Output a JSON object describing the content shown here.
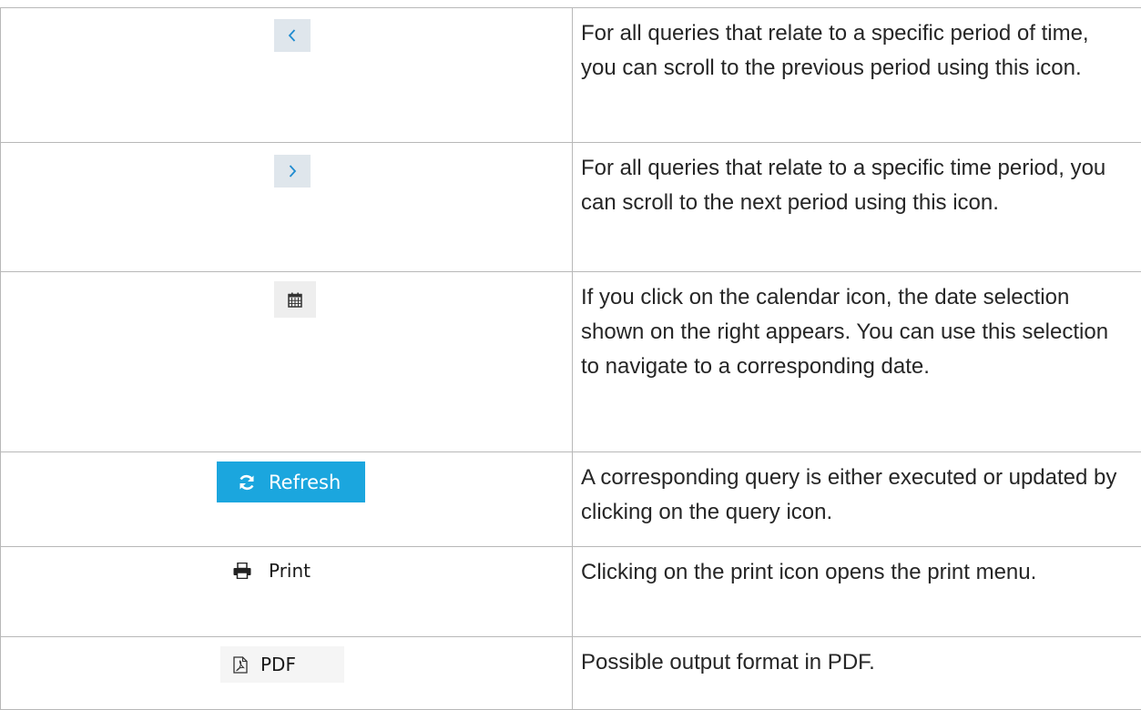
{
  "rows": [
    {
      "icon": "chevron-left-icon",
      "description": "For all queries that relate to a specific period of time, you can scroll to the previous period using this icon."
    },
    {
      "icon": "chevron-right-icon",
      "description": "For all queries that relate to a specific time period, you can scroll to the next period using this icon."
    },
    {
      "icon": "calendar-icon",
      "description": "If you click on the calendar icon, the date selection shown on the right appears. You can use this selection to navigate to a corresponding date."
    },
    {
      "icon": "refresh-icon",
      "button_label": "Refresh",
      "description": "A corresponding query is either executed or updated by clicking on the query icon."
    },
    {
      "icon": "printer-icon",
      "button_label": "Print",
      "description": "Clicking on the print icon opens the print menu."
    },
    {
      "icon": "pdf-file-icon",
      "button_label": "PDF",
      "description": "Possible output format in PDF."
    }
  ],
  "colors": {
    "accent_blue": "#1ba6de",
    "chevron_blue": "#1f8bd0",
    "nav_button_bg": "#dfe6ec",
    "border": "#b8b8b8",
    "text": "#262626"
  }
}
